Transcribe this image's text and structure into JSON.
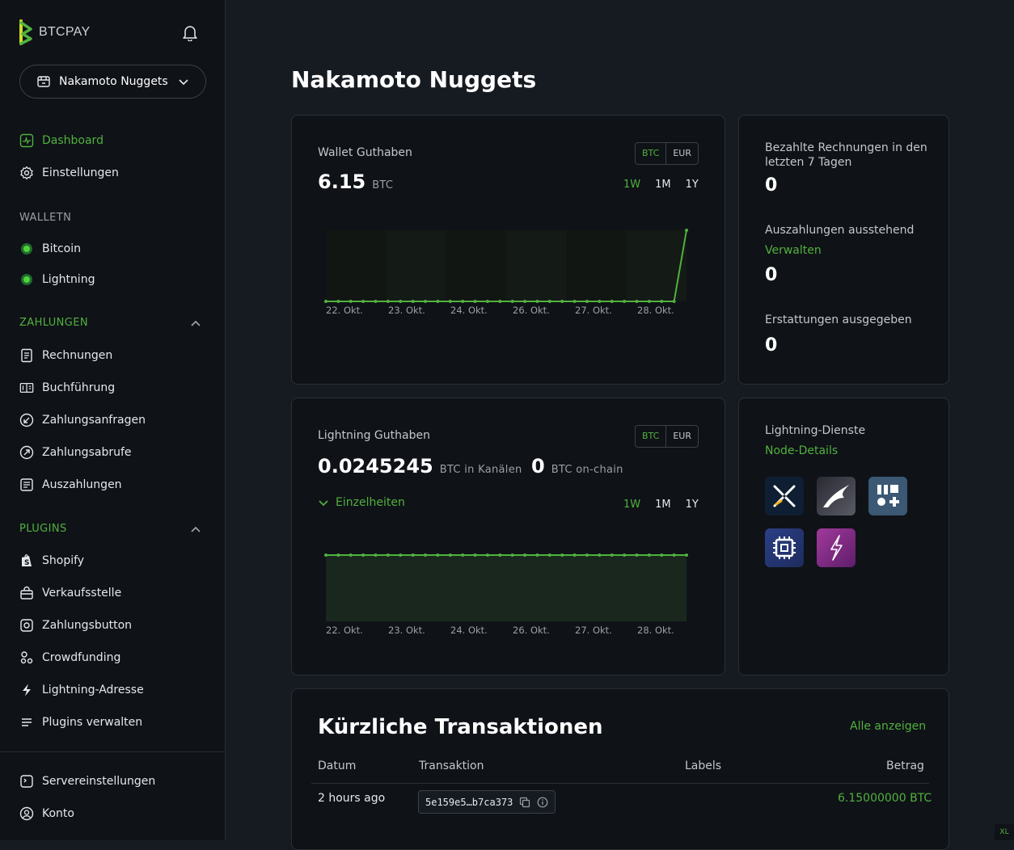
{
  "brand": {
    "name": "BTCPAY"
  },
  "store": {
    "name": "Nakamoto Nuggets"
  },
  "nav": {
    "dashboard": "Dashboard",
    "settings": "Einstellungen",
    "wallets_head": "WALLETN",
    "bitcoin": "Bitcoin",
    "lightning": "Lightning",
    "payments_head": "ZAHLUNGEN",
    "invoices": "Rechnungen",
    "accounting": "Buchführung",
    "payment_requests": "Zahlungsanfragen",
    "pull_payments": "Zahlungsabrufe",
    "payouts": "Auszahlungen",
    "plugins_head": "PLUGINS",
    "shopify": "Shopify",
    "pos": "Verkaufsstelle",
    "pay_button": "Zahlungsbutton",
    "crowdfunding": "Crowdfunding",
    "ln_address": "Lightning-Adresse",
    "manage_plugins": "Plugins verwalten",
    "server_settings": "Servereinstellungen",
    "account": "Konto"
  },
  "page_title": "Nakamoto Nuggets",
  "wallet": {
    "label": "Wallet Guthaben",
    "value": "6.15",
    "unit": "BTC",
    "cur_btc": "BTC",
    "cur_eur": "EUR",
    "range_1w": "1W",
    "range_1m": "1M",
    "range_1y": "1Y"
  },
  "stats": {
    "paid_invoices_label": "Bezahlte Rechnungen in den letzten 7 Tagen",
    "paid_invoices_value": "0",
    "pending_payouts_label": "Auszahlungen ausstehend",
    "pending_payouts_link": "Verwalten",
    "pending_payouts_value": "0",
    "refunds_label": "Erstattungen ausgegeben",
    "refunds_value": "0"
  },
  "lightning": {
    "label": "Lightning Guthaben",
    "channels_value": "0.0245245",
    "channels_unit": "BTC in Kanälen",
    "onchain_value": "0",
    "onchain_unit": "BTC on-chain",
    "details_toggle": "Einzelheiten",
    "cur_btc": "BTC",
    "cur_eur": "EUR",
    "range_1w": "1W",
    "range_1m": "1M",
    "range_1y": "1Y"
  },
  "ln_services": {
    "label": "Lightning-Dienste",
    "node_link": "Node-Details",
    "apps": [
      "ride-the-lightning-icon",
      "thunderhub-icon",
      "lightning-apps-icon",
      "lightning-node-icon",
      "lnbits-icon"
    ]
  },
  "chart_data": [
    {
      "type": "line",
      "title": "Wallet Guthaben",
      "xlabel": "",
      "ylabel": "",
      "x": [
        "22. Okt.",
        "23. Okt.",
        "24. Okt.",
        "26. Okt.",
        "27. Okt.",
        "28. Okt."
      ],
      "tick_labels": [
        "22. Okt.",
        "23. Okt.",
        "24. Okt.",
        "26. Okt.",
        "27. Okt.",
        "28. Okt."
      ],
      "series": [
        {
          "values": [
            0,
            0,
            0,
            0,
            0,
            0,
            0,
            0,
            0,
            0,
            0,
            0,
            0,
            0,
            0,
            0,
            0,
            0,
            0,
            0,
            0,
            0,
            0,
            0,
            0,
            0,
            0,
            0,
            0,
            6.15
          ]
        }
      ],
      "ylim": [
        0,
        6.15
      ],
      "grid": false,
      "color": "#51b13e"
    },
    {
      "type": "area",
      "title": "Lightning Guthaben",
      "xlabel": "",
      "ylabel": "",
      "x": [
        "22. Okt.",
        "23. Okt.",
        "24. Okt.",
        "26. Okt.",
        "27. Okt.",
        "28. Okt."
      ],
      "tick_labels": [
        "22. Okt.",
        "23. Okt.",
        "24. Okt.",
        "26. Okt.",
        "27. Okt.",
        "28. Okt."
      ],
      "series": [
        {
          "values": [
            0.0245245,
            0.0245245,
            0.0245245,
            0.0245245,
            0.0245245,
            0.0245245,
            0.0245245,
            0.0245245,
            0.0245245,
            0.0245245,
            0.0245245,
            0.0245245,
            0.0245245,
            0.0245245,
            0.0245245,
            0.0245245,
            0.0245245,
            0.0245245,
            0.0245245,
            0.0245245,
            0.0245245,
            0.0245245,
            0.0245245,
            0.0245245,
            0.0245245,
            0.0245245,
            0.0245245,
            0.0245245,
            0.0245245,
            0.0245245
          ]
        }
      ],
      "ylim": [
        0,
        0.0245245
      ],
      "grid": false,
      "color": "#51b13e"
    }
  ],
  "transactions": {
    "title": "Kürzliche Transaktionen",
    "view_all": "Alle anzeigen",
    "headers": {
      "date": "Datum",
      "tx": "Transaktion",
      "labels": "Labels",
      "amount": "Betrag"
    },
    "rows": [
      {
        "date": "2 hours ago",
        "tx": "5e159e5…b7ca373",
        "amount": "6.15000000 BTC"
      }
    ]
  },
  "breakpoint_badge": "XL",
  "colors": {
    "accent": "#51b13e",
    "bg": "#161b22",
    "panel": "#0f1217"
  }
}
